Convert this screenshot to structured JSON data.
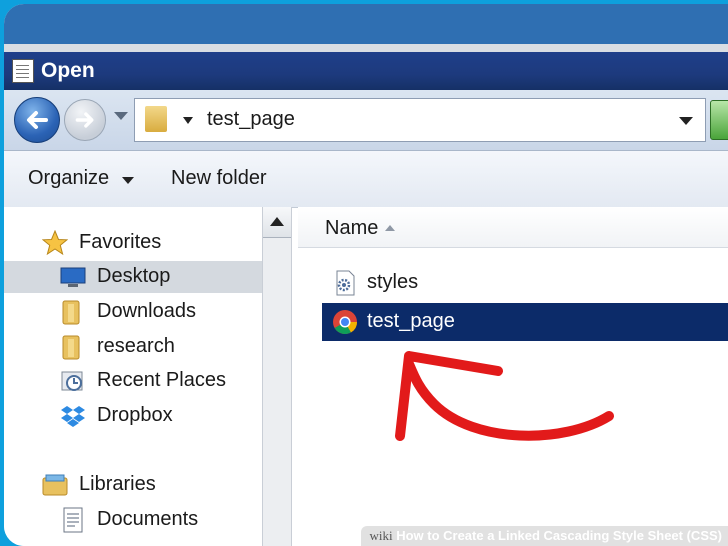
{
  "window": {
    "title": "Open"
  },
  "address": {
    "path": "test_page"
  },
  "toolbar": {
    "organize_label": "Organize",
    "new_folder_label": "New folder"
  },
  "nav": {
    "favorites_header": "Favorites",
    "items": [
      {
        "label": "Desktop",
        "icon": "desktop-icon",
        "selected": true
      },
      {
        "label": "Downloads",
        "icon": "folder-icon"
      },
      {
        "label": "research",
        "icon": "folder-icon"
      },
      {
        "label": "Recent Places",
        "icon": "recent-places-icon"
      },
      {
        "label": "Dropbox",
        "icon": "dropbox-icon"
      }
    ],
    "libraries_header": "Libraries",
    "library_items": [
      {
        "label": "Documents",
        "icon": "documents-icon"
      }
    ]
  },
  "files": {
    "column_name": "Name",
    "rows": [
      {
        "label": "styles",
        "icon": "gear-file-icon",
        "selected": false
      },
      {
        "label": "test_page",
        "icon": "chrome-icon",
        "selected": true
      }
    ]
  },
  "watermark": {
    "wiki": "wiki",
    "text": "How to Create a Linked Cascading Style Sheet (CSS)"
  },
  "colors": {
    "selection": "#0c2b69",
    "arrow": "#e21a1a",
    "frame": "#0ea0dd"
  }
}
